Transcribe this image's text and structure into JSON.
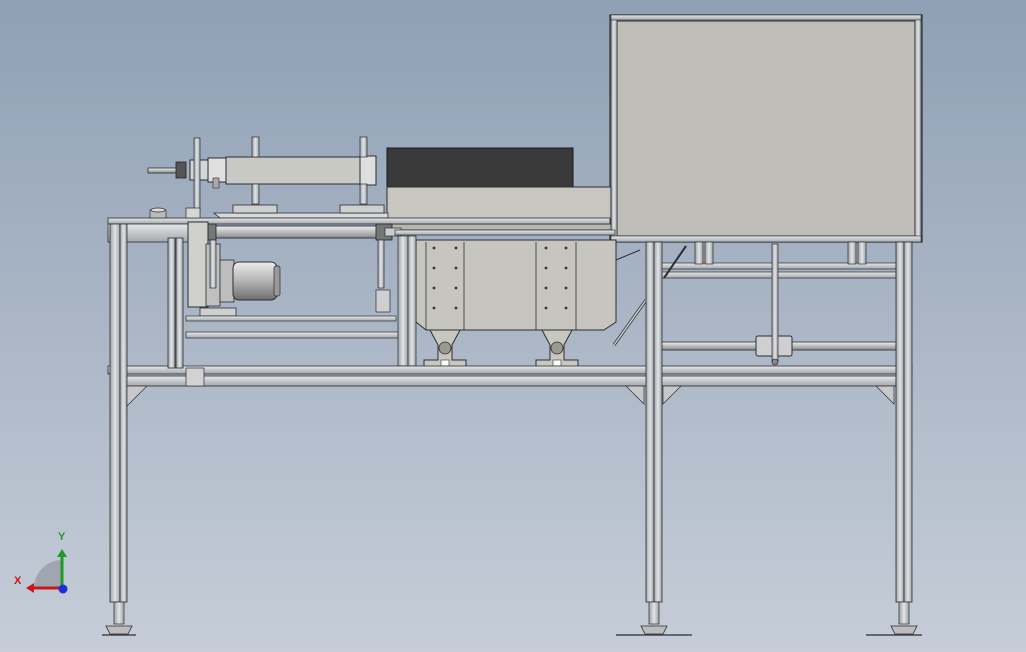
{
  "view": {
    "background_top": "#8fa0b5",
    "background_bottom": "#c6cdd8",
    "line_color": "#2a2d33",
    "metal_light": "#d9dbdd",
    "metal_mid": "#b9bcbf",
    "panel_fill": "#bebeb6",
    "dark_block": "#3a3a3a"
  },
  "triad": {
    "x_label": "X",
    "y_label": "Y",
    "x_color": "#c81818",
    "y_color": "#1f9a2a",
    "z_color": "#1b2fd6"
  }
}
